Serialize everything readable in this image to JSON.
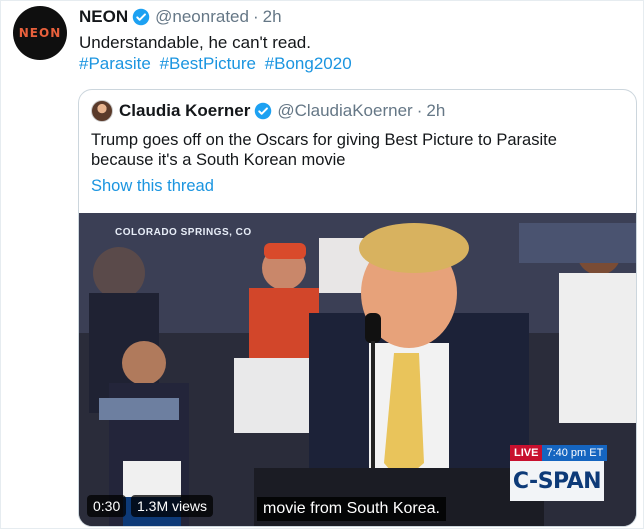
{
  "tweet": {
    "display_name": "NEON",
    "avatar_text": "NEON",
    "handle": "@neonrated",
    "separator": "·",
    "time": "2h",
    "text": "Understandable, he can't read.",
    "hashtags": [
      "#Parasite",
      "#BestPicture",
      "#Bong2020"
    ]
  },
  "quoted": {
    "display_name": "Claudia Koerner",
    "handle": "@ClaudiaKoerner",
    "separator": "·",
    "time": "2h",
    "text_lines": [
      "Trump goes off on the Oscars for giving Best Picture to Parasite",
      "because it's a South Korean movie"
    ],
    "show_thread": "Show this thread"
  },
  "video": {
    "location": "COLORADO SPRINGS, CO",
    "caption": "movie from South Korea.",
    "live_label": "LIVE",
    "live_time": "7:40 pm ET",
    "network": "C-SPAN",
    "duration": "0:30",
    "views": "1.3M views"
  },
  "colors": {
    "link": "#1b95e0",
    "muted": "#657786",
    "verified": "#1da1f2",
    "neon_logo": "#e8603c"
  }
}
